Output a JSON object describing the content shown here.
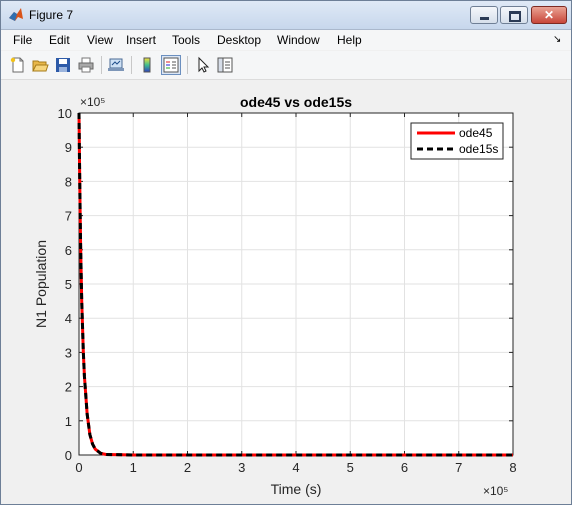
{
  "window": {
    "title": "Figure 7"
  },
  "menu": [
    "File",
    "Edit",
    "View",
    "Insert",
    "Tools",
    "Desktop",
    "Window",
    "Help"
  ],
  "toolbar_icons": [
    "new-figure-icon",
    "open-file-icon",
    "save-icon",
    "print-icon",
    "link-plot-icon",
    "colorbar-icon",
    "legend-icon",
    "pointer-icon",
    "property-editor-icon"
  ],
  "colors": {
    "ode45": "#ff0000",
    "ode15s": "#000000"
  },
  "chart_data": {
    "type": "line",
    "title": "ode45 vs ode15s",
    "xlabel": "Time (s)",
    "ylabel": "N1 Population",
    "x_exponent": "×10⁵",
    "y_exponent": "×10⁵",
    "xlim": [
      0,
      8
    ],
    "ylim": [
      0,
      10
    ],
    "xticks": [
      "0",
      "1",
      "2",
      "3",
      "4",
      "5",
      "6",
      "7",
      "8"
    ],
    "yticks": [
      "0",
      "1",
      "2",
      "3",
      "4",
      "5",
      "6",
      "7",
      "8",
      "9",
      "10"
    ],
    "grid": true,
    "legend_position": "top-right",
    "series": [
      {
        "name": "ode45",
        "style": "solid",
        "x": [
          0,
          0.01,
          0.02,
          0.03,
          0.05,
          0.08,
          0.1,
          0.15,
          0.2,
          0.25,
          0.3,
          0.4,
          0.5,
          1,
          2,
          4,
          8
        ],
        "y": [
          10,
          8.5,
          7.2,
          6.1,
          4.5,
          3.0,
          2.3,
          1.2,
          0.6,
          0.32,
          0.17,
          0.05,
          0.015,
          0,
          0,
          0,
          0
        ]
      },
      {
        "name": "ode15s",
        "style": "dashed",
        "x": [
          0,
          0.01,
          0.02,
          0.03,
          0.05,
          0.08,
          0.1,
          0.15,
          0.2,
          0.25,
          0.3,
          0.4,
          0.5,
          1,
          2,
          4,
          8
        ],
        "y": [
          10,
          8.5,
          7.2,
          6.1,
          4.5,
          3.0,
          2.3,
          1.2,
          0.6,
          0.32,
          0.17,
          0.05,
          0.015,
          0,
          0,
          0,
          0
        ]
      }
    ]
  }
}
